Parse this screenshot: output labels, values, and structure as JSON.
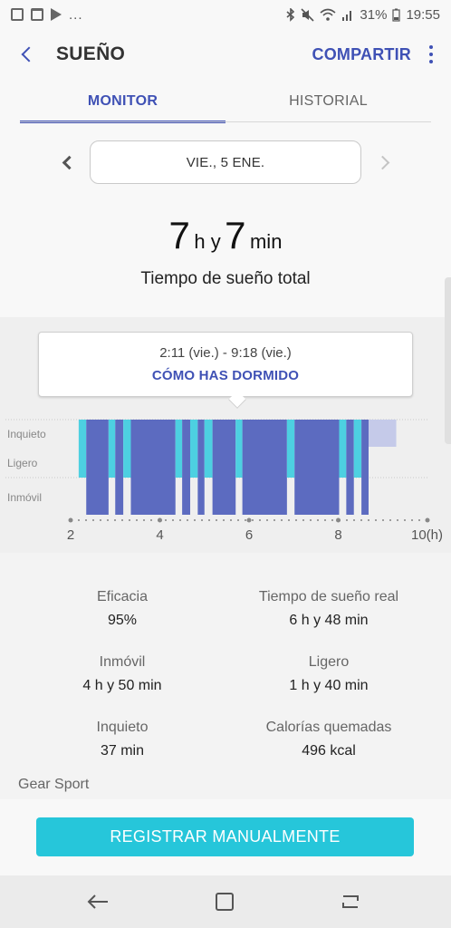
{
  "status_bar": {
    "more_indicator": "...",
    "battery_percent": "31%",
    "time": "19:55",
    "icons": [
      "image-icon",
      "shopping-bag-icon",
      "play-store-icon",
      "bluetooth-icon",
      "mute-icon",
      "wifi-icon",
      "signal-icon",
      "battery-icon"
    ]
  },
  "header": {
    "title": "SUEÑO",
    "share_label": "COMPARTIR"
  },
  "tabs": [
    {
      "label": "MONITOR",
      "active": true
    },
    {
      "label": "HISTORIAL",
      "active": false
    }
  ],
  "date_selector": {
    "date": "VIE., 5 ENE."
  },
  "summary": {
    "hours": "7",
    "hours_unit": "h y",
    "minutes": "7",
    "minutes_unit": "min",
    "label": "Tiempo de sueño total"
  },
  "tooltip": {
    "time_range": "2:11 (vie.) - 9:18 (vie.)",
    "link": "CÓMO HAS DORMIDO"
  },
  "chart_data": {
    "type": "bar",
    "levels": [
      "Inquieto",
      "Ligero",
      "Inmóvil"
    ],
    "x_ticks": [
      "2",
      "4",
      "6",
      "8",
      "10(h)"
    ],
    "xlim": [
      2,
      10
    ],
    "colors": {
      "inmovil": "#5c6bc0",
      "ligero": "#4dd0e1",
      "inquieto": "#4dd0e1",
      "pending": "#c5cae9"
    },
    "segments": [
      {
        "start": 2.18,
        "end": 2.35,
        "level": "Ligero"
      },
      {
        "start": 2.35,
        "end": 2.85,
        "level": "Inmóvil"
      },
      {
        "start": 2.85,
        "end": 3.0,
        "level": "Ligero"
      },
      {
        "start": 3.0,
        "end": 3.18,
        "level": "Inmóvil"
      },
      {
        "start": 3.18,
        "end": 3.35,
        "level": "Ligero"
      },
      {
        "start": 3.35,
        "end": 4.35,
        "level": "Inmóvil"
      },
      {
        "start": 4.35,
        "end": 4.5,
        "level": "Ligero"
      },
      {
        "start": 4.5,
        "end": 4.68,
        "level": "Inmóvil"
      },
      {
        "start": 4.68,
        "end": 4.85,
        "level": "Ligero"
      },
      {
        "start": 4.85,
        "end": 5.0,
        "level": "Inmóvil"
      },
      {
        "start": 5.0,
        "end": 5.18,
        "level": "Ligero"
      },
      {
        "start": 5.18,
        "end": 5.7,
        "level": "Inmóvil"
      },
      {
        "start": 5.7,
        "end": 5.85,
        "level": "Ligero"
      },
      {
        "start": 5.85,
        "end": 6.85,
        "level": "Inmóvil"
      },
      {
        "start": 6.85,
        "end": 7.02,
        "level": "Ligero"
      },
      {
        "start": 7.02,
        "end": 8.02,
        "level": "Inmóvil"
      },
      {
        "start": 8.02,
        "end": 8.18,
        "level": "Ligero"
      },
      {
        "start": 8.18,
        "end": 8.35,
        "level": "Inmóvil"
      },
      {
        "start": 8.35,
        "end": 8.52,
        "level": "Ligero"
      },
      {
        "start": 8.52,
        "end": 8.68,
        "level": "Inmóvil"
      },
      {
        "start": 8.68,
        "end": 9.3,
        "level": "Pending"
      }
    ]
  },
  "stats": [
    {
      "label": "Eficacia",
      "value": "95%"
    },
    {
      "label": "Tiempo de sueño real",
      "value": "6 h y 48 min"
    },
    {
      "label": "Inmóvil",
      "value": "4 h y 50 min"
    },
    {
      "label": "Ligero",
      "value": "1 h y 40 min"
    },
    {
      "label": "Inquieto",
      "value": "37 min"
    },
    {
      "label": "Calorías quemadas",
      "value": "496 kcal"
    }
  ],
  "source": "Gear Sport",
  "register_button": "REGISTRAR MANUALMENTE",
  "nav": {
    "back_icon": "back-arrow-icon",
    "home_icon": "home-icon",
    "recents_icon": "recents-icon"
  }
}
